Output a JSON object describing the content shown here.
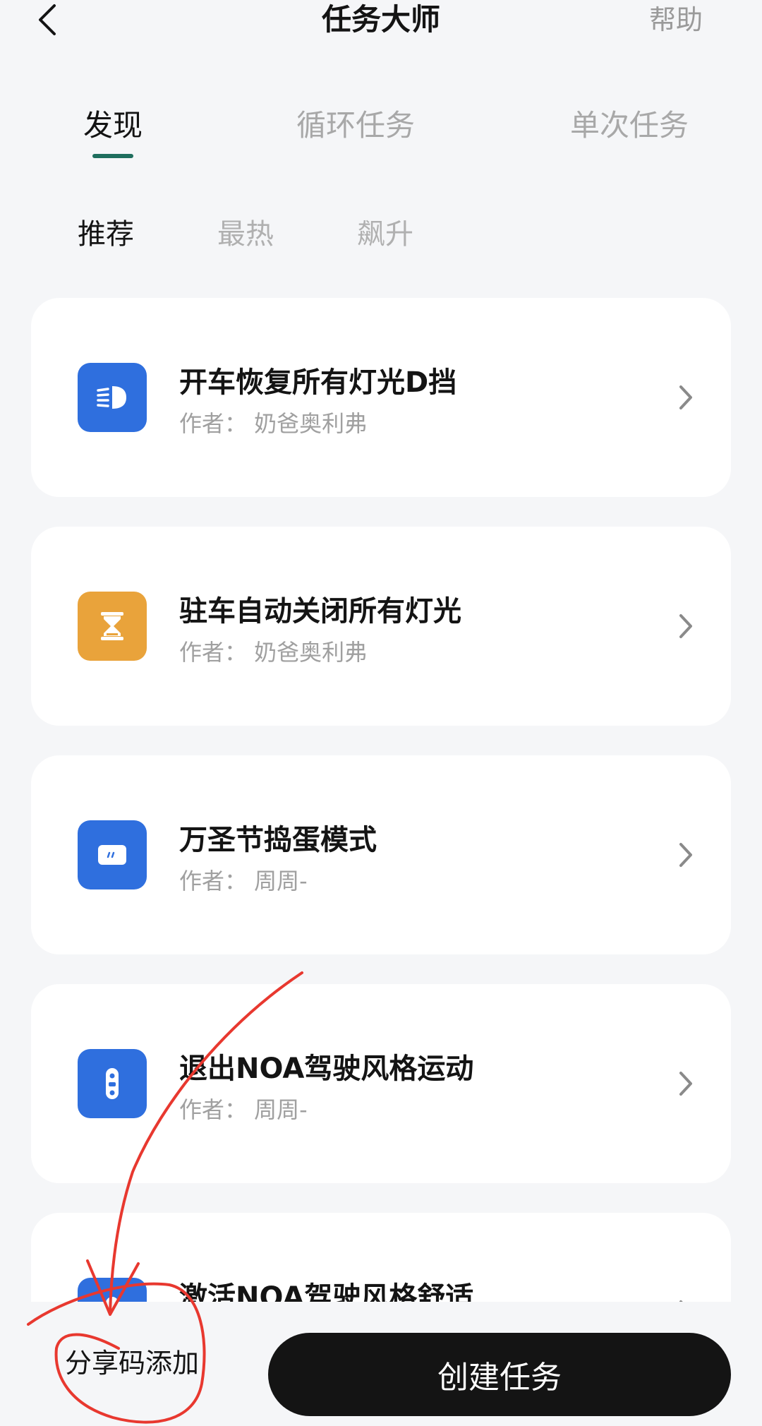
{
  "header": {
    "title": "任务大师",
    "help_label": "帮助"
  },
  "main_tabs": [
    {
      "label": "发现",
      "active": true
    },
    {
      "label": "循环任务",
      "active": false
    },
    {
      "label": "单次任务",
      "active": false
    }
  ],
  "sub_tabs": [
    {
      "label": "推荐",
      "active": true
    },
    {
      "label": "最热",
      "active": false
    },
    {
      "label": "飙升",
      "active": false
    }
  ],
  "tasks": [
    {
      "title": "开车恢复所有灯光D挡",
      "author": "作者：  奶爸奥利弗",
      "icon": "headlight-icon",
      "icon_color": "#2f6fde"
    },
    {
      "title": "驻车自动关闭所有灯光",
      "author": "作者：  奶爸奥利弗",
      "icon": "hourglass-icon",
      "icon_color": "#e9a33b"
    },
    {
      "title": "万圣节捣蛋模式",
      "author": "作者：  周周-",
      "icon": "message-bubble-icon",
      "icon_color": "#2f6fde"
    },
    {
      "title": "退出NOA驾驶风格运动",
      "author": "作者：  周周-",
      "icon": "car-key-icon",
      "icon_color": "#2f6fde"
    },
    {
      "title": "激活NOA驾驶风格舒适",
      "author": "",
      "icon": "car-key-icon",
      "icon_color": "#2f6fde"
    }
  ],
  "bottom": {
    "share_code_label": "分享码添加",
    "create_task_label": "创建任务"
  },
  "colors": {
    "background": "#f5f6f8",
    "tab_indicator": "#1f6e5e",
    "annotation": "#e8382f"
  }
}
